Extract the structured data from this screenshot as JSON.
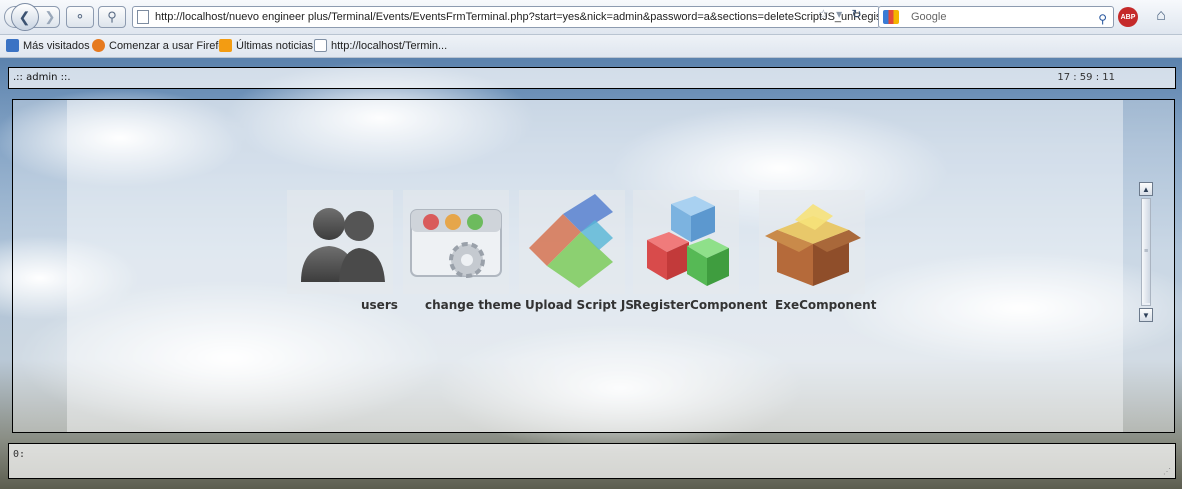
{
  "browser": {
    "url": "http://localhost/nuevo engineer plus/Terminal/Events/EventsFrmTerminal.php?start=yes&nick=admin&password=a&sections=deleteScriptJS_unRegiste",
    "search_placeholder": "Google",
    "abp_label": "ABP",
    "bookmarks": [
      {
        "label": "Más visitados",
        "icon": "most-visited-icon",
        "color": "#3b73c4"
      },
      {
        "label": "Comenzar a usar Firefox",
        "icon": "firefox-icon",
        "color": "#e67a1f"
      },
      {
        "label": "Últimas noticias",
        "icon": "rss-icon",
        "color": "#f39c12"
      },
      {
        "label": "http://localhost/Termin...",
        "icon": "page-icon",
        "color": "#ffffff"
      }
    ]
  },
  "terminal": {
    "user_label": ".:: admin ::.",
    "clock": "17 : 59 : 11",
    "console_prompt": "0:"
  },
  "apps": [
    {
      "label": "users",
      "icon": "users-icon"
    },
    {
      "label": "change theme",
      "icon": "change-theme-icon"
    },
    {
      "label": "Upload Script JS",
      "icon": "upload-script-icon"
    },
    {
      "label": "RegisterComponent",
      "icon": "register-component-icon"
    },
    {
      "label": "ExeComponent",
      "icon": "exe-component-icon"
    }
  ]
}
